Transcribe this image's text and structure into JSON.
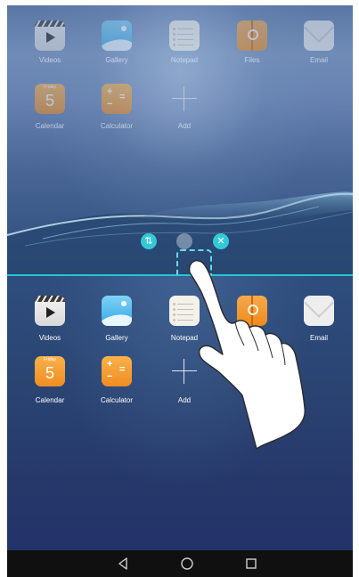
{
  "top_screen": {
    "apps": [
      {
        "id": "videos",
        "label": "Videos"
      },
      {
        "id": "gallery",
        "label": "Gallery"
      },
      {
        "id": "notepad",
        "label": "Notepad"
      },
      {
        "id": "files",
        "label": "Files"
      },
      {
        "id": "email",
        "label": "Email"
      },
      {
        "id": "calendar",
        "label": "Calendar",
        "day": "Friday",
        "date": "5"
      },
      {
        "id": "calculator",
        "label": "Calculator"
      },
      {
        "id": "add",
        "label": "Add"
      }
    ]
  },
  "split_controls": {
    "swap_icon": "swap-icon",
    "drag_handle_icon": "drag-handle-icon",
    "close_icon": "close-icon",
    "accent": "#26c4d8"
  },
  "bottom_screen": {
    "apps": [
      {
        "id": "videos",
        "label": "Videos"
      },
      {
        "id": "gallery",
        "label": "Gallery"
      },
      {
        "id": "notepad",
        "label": "Notepad"
      },
      {
        "id": "files",
        "label": ""
      },
      {
        "id": "email",
        "label": "Email"
      },
      {
        "id": "calendar",
        "label": "Calendar",
        "day": "Friday",
        "date": "5"
      },
      {
        "id": "calculator",
        "label": "Calculator"
      },
      {
        "id": "add",
        "label": "Add"
      }
    ]
  },
  "navbar": {
    "back_icon": "back-icon",
    "home_icon": "home-icon",
    "recents_icon": "recents-icon"
  }
}
